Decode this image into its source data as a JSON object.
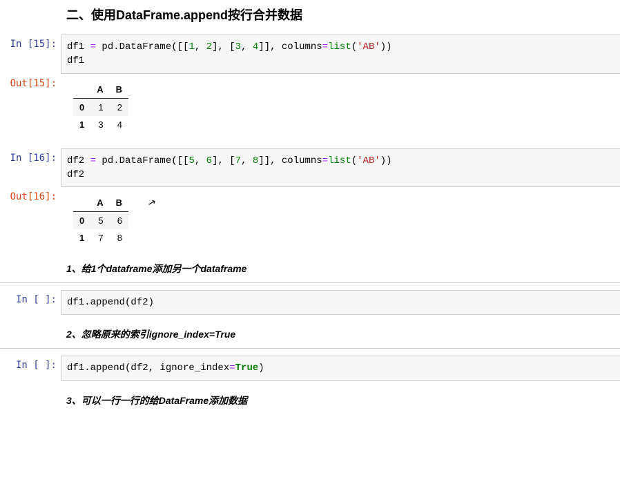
{
  "headings": {
    "h3_main": "二、使用DataFrame.append按行合并数据",
    "h4_1": "1、给1个dataframe添加另一个dataframe",
    "h4_2": "2、忽略原来的索引ignore_index=True",
    "h4_3": "3、可以一行一行的给DataFrame添加数据"
  },
  "cells": {
    "c15": {
      "in_prompt": "In  [15]:",
      "out_prompt": "Out[15]:",
      "code": {
        "l1_pre": "df1 ",
        "l1_eq": "=",
        "l1_mid": " pd.DataFrame([[",
        "l1_n1": "1",
        "l1_c1": ", ",
        "l1_n2": "2",
        "l1_c2": "], [",
        "l1_n3": "3",
        "l1_c3": ", ",
        "l1_n4": "4",
        "l1_c4": "]], columns",
        "l1_eq2": "=",
        "l1_list": "list",
        "l1_paren1": "(",
        "l1_str": "'AB'",
        "l1_paren2": "))",
        "l2": "df1"
      },
      "table": {
        "cols": [
          "A",
          "B"
        ],
        "idx": [
          "0",
          "1"
        ],
        "rows": [
          [
            "1",
            "2"
          ],
          [
            "3",
            "4"
          ]
        ]
      }
    },
    "c16": {
      "in_prompt": "In  [16]:",
      "out_prompt": "Out[16]:",
      "code": {
        "l1_pre": "df2 ",
        "l1_eq": "=",
        "l1_mid": " pd.DataFrame([[",
        "l1_n1": "5",
        "l1_c1": ", ",
        "l1_n2": "6",
        "l1_c2": "], [",
        "l1_n3": "7",
        "l1_c3": ", ",
        "l1_n4": "8",
        "l1_c4": "]], columns",
        "l1_eq2": "=",
        "l1_list": "list",
        "l1_paren1": "(",
        "l1_str": "'AB'",
        "l1_paren2": "))",
        "l2": "df2"
      },
      "table": {
        "cols": [
          "A",
          "B"
        ],
        "idx": [
          "0",
          "1"
        ],
        "rows": [
          [
            "5",
            "6"
          ],
          [
            "7",
            "8"
          ]
        ]
      }
    },
    "c_empty1": {
      "in_prompt": "In  [  ]:",
      "code_text": "df1.append(df2)"
    },
    "c_empty2": {
      "in_prompt": "In  [  ]:",
      "code": {
        "pre": "df1.append(df2, ignore_index",
        "eq": "=",
        "kw": "True",
        "post": ")"
      }
    }
  },
  "cursor_glyph": "↖"
}
